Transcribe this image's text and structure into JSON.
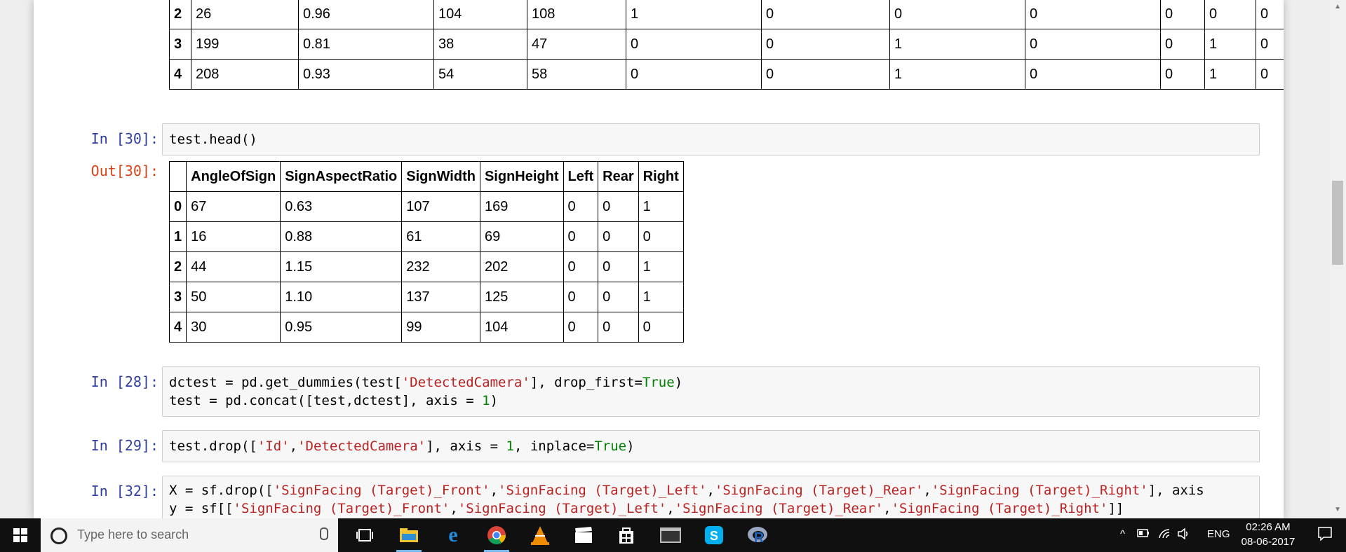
{
  "top_table": {
    "rows": [
      [
        "2",
        "26",
        "0.96",
        "104",
        "108",
        "1",
        "0",
        "0",
        "0",
        "0",
        "0",
        "0"
      ],
      [
        "3",
        "199",
        "0.81",
        "38",
        "47",
        "0",
        "0",
        "1",
        "0",
        "0",
        "1",
        "0"
      ],
      [
        "4",
        "208",
        "0.93",
        "54",
        "58",
        "0",
        "0",
        "1",
        "0",
        "0",
        "1",
        "0"
      ]
    ]
  },
  "cells": {
    "c30": {
      "prompt": "In [30]:",
      "code": "test.head()"
    },
    "out30": {
      "prompt": "Out[30]:",
      "columns": [
        "",
        "AngleOfSign",
        "SignAspectRatio",
        "SignWidth",
        "SignHeight",
        "Left",
        "Rear",
        "Right"
      ],
      "rows": [
        [
          "0",
          "67",
          "0.63",
          "107",
          "169",
          "0",
          "0",
          "1"
        ],
        [
          "1",
          "16",
          "0.88",
          "61",
          "69",
          "0",
          "0",
          "0"
        ],
        [
          "2",
          "44",
          "1.15",
          "232",
          "202",
          "0",
          "0",
          "1"
        ],
        [
          "3",
          "50",
          "1.10",
          "137",
          "125",
          "0",
          "0",
          "1"
        ],
        [
          "4",
          "30",
          "0.95",
          "99",
          "104",
          "0",
          "0",
          "0"
        ]
      ]
    },
    "c28": {
      "prompt": "In [28]:"
    },
    "c29": {
      "prompt": "In [29]:"
    },
    "c32": {
      "prompt": "In [32]:"
    }
  },
  "taskbar": {
    "search_placeholder": "Type here to search",
    "language": "ENG",
    "time": "02:26 AM",
    "date": "08-06-2017",
    "colors": {
      "bg": "#101010",
      "accent": "#76b9ed"
    }
  }
}
